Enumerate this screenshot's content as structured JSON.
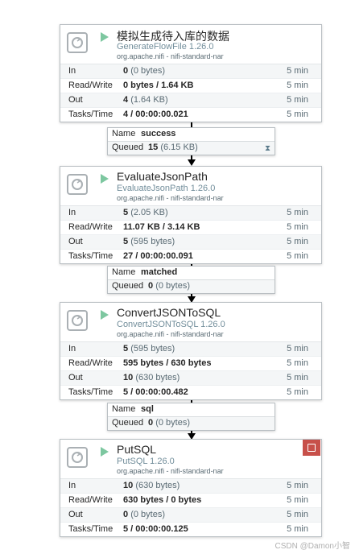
{
  "processors": [
    {
      "name": "模拟生成待入库的数据",
      "type": "GenerateFlowFile 1.26.0",
      "bundle": "org.apache.nifi - nifi-standard-nar",
      "stats": [
        {
          "label": "In",
          "bold": "0",
          "muted": "(0 bytes)",
          "time": "5 min"
        },
        {
          "label": "Read/Write",
          "bold": "0 bytes / 1.64 KB",
          "muted": "",
          "time": "5 min"
        },
        {
          "label": "Out",
          "bold": "4",
          "muted": "(1.64 KB)",
          "time": "5 min"
        },
        {
          "label": "Tasks/Time",
          "bold": "4 / 00:00:00.021",
          "muted": "",
          "time": "5 min"
        }
      ]
    },
    {
      "name": "EvaluateJsonPath",
      "type": "EvaluateJsonPath 1.26.0",
      "bundle": "org.apache.nifi - nifi-standard-nar",
      "stats": [
        {
          "label": "In",
          "bold": "5",
          "muted": "(2.05 KB)",
          "time": "5 min"
        },
        {
          "label": "Read/Write",
          "bold": "11.07 KB / 3.14 KB",
          "muted": "",
          "time": "5 min"
        },
        {
          "label": "Out",
          "bold": "5",
          "muted": "(595 bytes)",
          "time": "5 min"
        },
        {
          "label": "Tasks/Time",
          "bold": "27 / 00:00:00.091",
          "muted": "",
          "time": "5 min"
        }
      ]
    },
    {
      "name": "ConvertJSONToSQL",
      "type": "ConvertJSONToSQL 1.26.0",
      "bundle": "org.apache.nifi - nifi-standard-nar",
      "stats": [
        {
          "label": "In",
          "bold": "5",
          "muted": "(595 bytes)",
          "time": "5 min"
        },
        {
          "label": "Read/Write",
          "bold": "595 bytes / 630 bytes",
          "muted": "",
          "time": "5 min"
        },
        {
          "label": "Out",
          "bold": "10",
          "muted": "(630 bytes)",
          "time": "5 min"
        },
        {
          "label": "Tasks/Time",
          "bold": "5 / 00:00:00.482",
          "muted": "",
          "time": "5 min"
        }
      ]
    },
    {
      "name": "PutSQL",
      "type": "PutSQL 1.26.0",
      "bundle": "org.apache.nifi - nifi-standard-nar",
      "stats": [
        {
          "label": "In",
          "bold": "10",
          "muted": "(630 bytes)",
          "time": "5 min"
        },
        {
          "label": "Read/Write",
          "bold": "630 bytes / 0 bytes",
          "muted": "",
          "time": "5 min"
        },
        {
          "label": "Out",
          "bold": "0",
          "muted": "(0 bytes)",
          "time": "5 min"
        },
        {
          "label": "Tasks/Time",
          "bold": "5 / 00:00:00.125",
          "muted": "",
          "time": "5 min"
        }
      ]
    }
  ],
  "connections": [
    {
      "name_label": "Name",
      "name": "success",
      "queued_label": "Queued",
      "count": "15",
      "size": "(6.15 KB)",
      "hourglass": "hourglass-icon"
    },
    {
      "name_label": "Name",
      "name": "matched",
      "queued_label": "Queued",
      "count": "0",
      "size": "(0 bytes)"
    },
    {
      "name_label": "Name",
      "name": "sql",
      "queued_label": "Queued",
      "count": "0",
      "size": "(0 bytes)"
    }
  ],
  "bulletin_icon": "bulletin-icon",
  "watermark": "CSDN @Damon小智",
  "colors": {
    "run": "#7dc7a0",
    "bulletin": "#c7504a",
    "type_text": "#728e9b"
  }
}
